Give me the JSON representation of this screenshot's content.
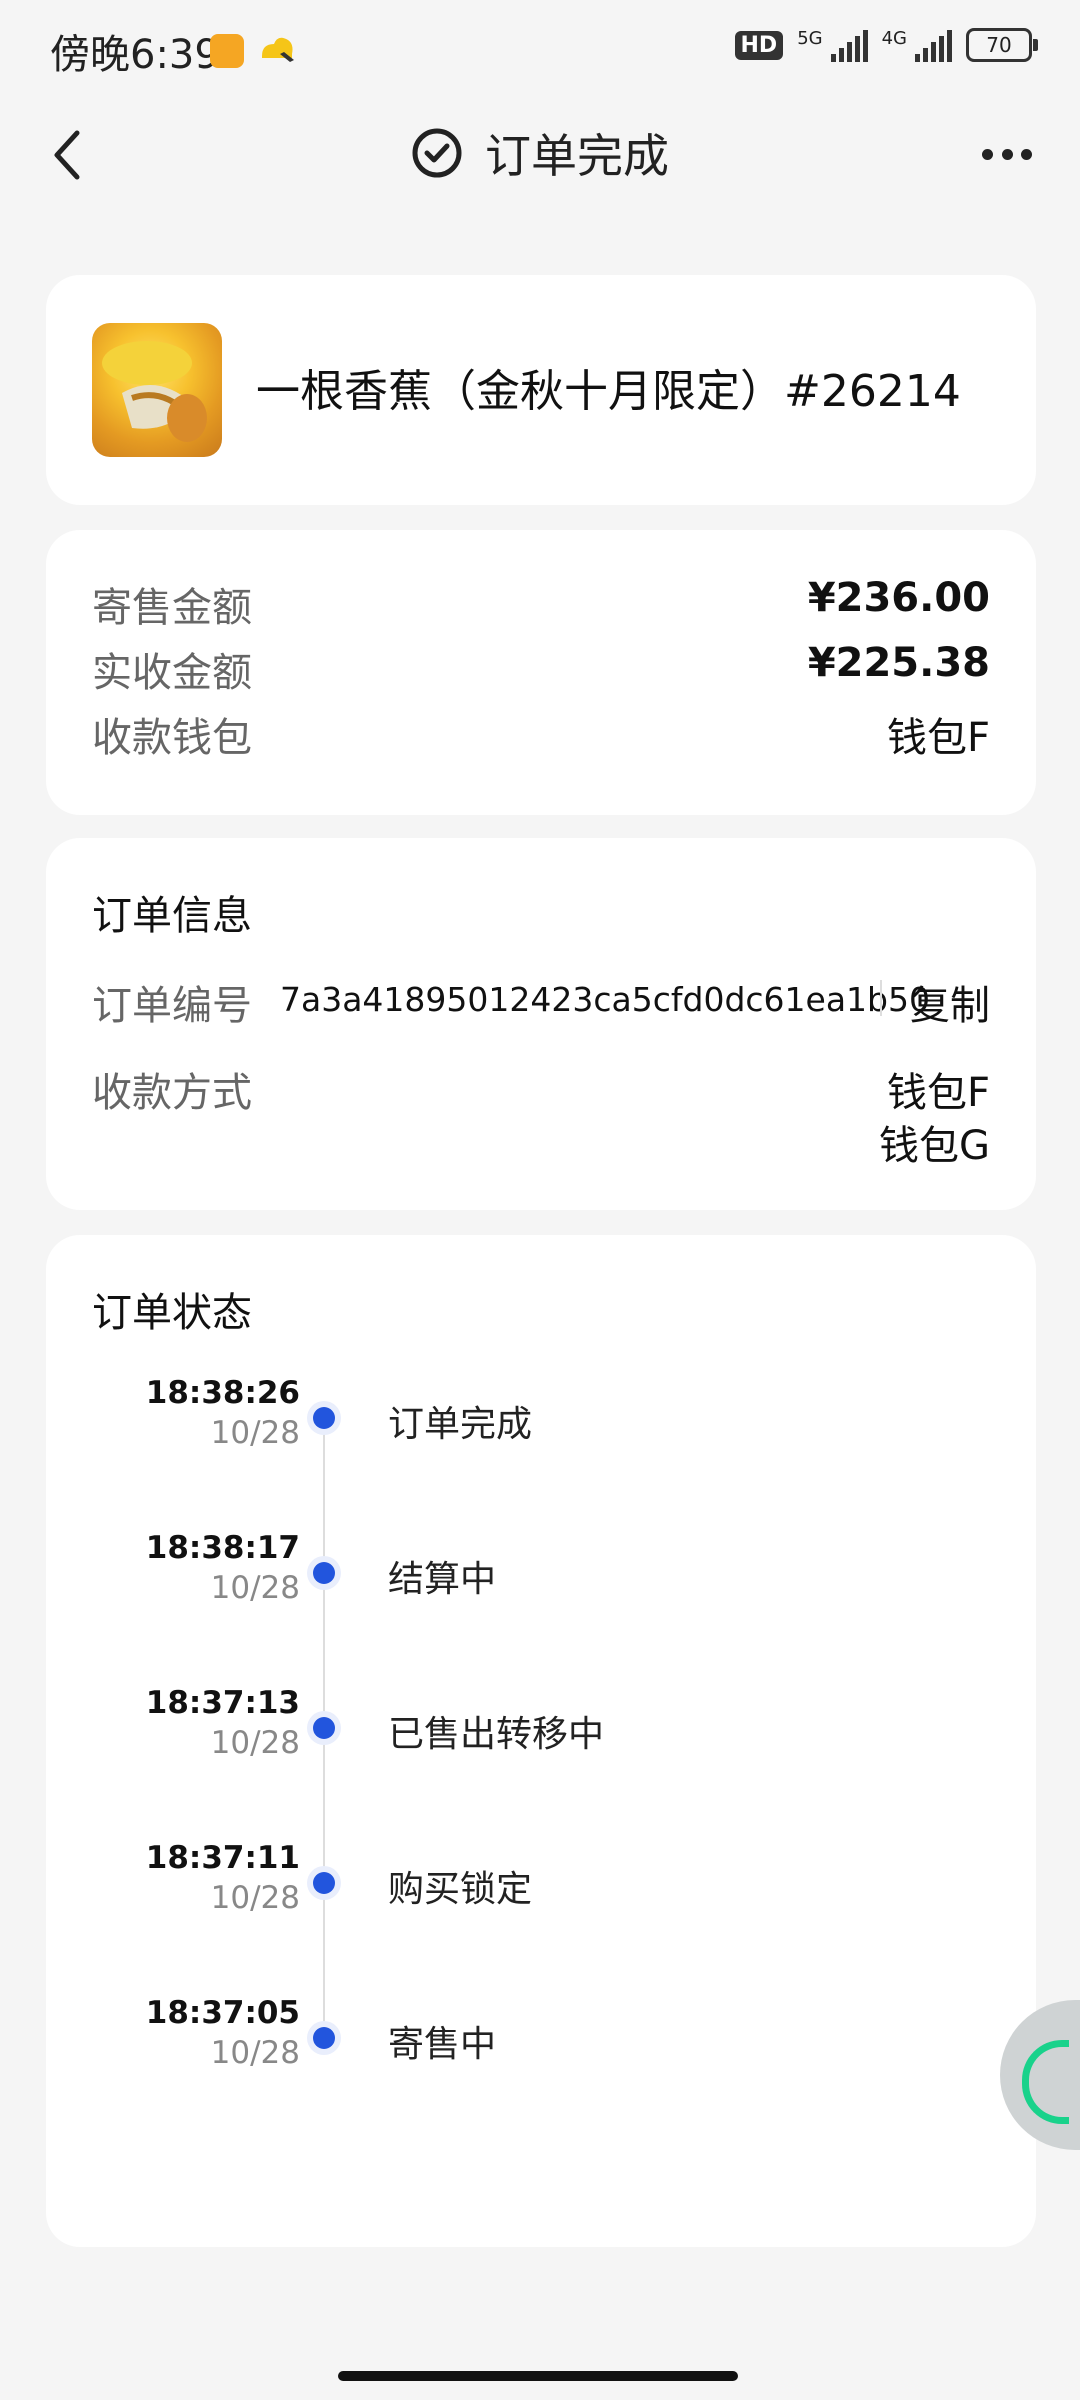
{
  "status_bar": {
    "time": "傍晚6:39",
    "hd": "HD",
    "net1": "5G",
    "net2": "4G",
    "battery": "70"
  },
  "nav": {
    "title": "订单完成"
  },
  "product": {
    "name": "一根香蕉（金秋十月限定）#26214"
  },
  "amounts": {
    "sale_label": "寄售金额",
    "sale_value": "¥236.00",
    "received_label": "实收金额",
    "received_value": "¥225.38",
    "wallet_label": "收款钱包",
    "wallet_value": "钱包F"
  },
  "order_info": {
    "title": "订单信息",
    "id_label": "订单编号",
    "id_value": "7a3a41895012423ca5cfd0dc61ea1b50",
    "copy_label": "复制",
    "method_label": "收款方式",
    "method_values": [
      "钱包F",
      "钱包G"
    ]
  },
  "order_status": {
    "title": "订单状态",
    "events": [
      {
        "time": "18:38:26",
        "date": "10/28",
        "label": "订单完成"
      },
      {
        "time": "18:38:17",
        "date": "10/28",
        "label": "结算中"
      },
      {
        "time": "18:37:13",
        "date": "10/28",
        "label": "已售出转移中"
      },
      {
        "time": "18:37:11",
        "date": "10/28",
        "label": "购买锁定"
      },
      {
        "time": "18:37:05",
        "date": "10/28",
        "label": "寄售中"
      }
    ]
  },
  "colors": {
    "accent": "#2255dd",
    "float_green": "#19d28b"
  }
}
